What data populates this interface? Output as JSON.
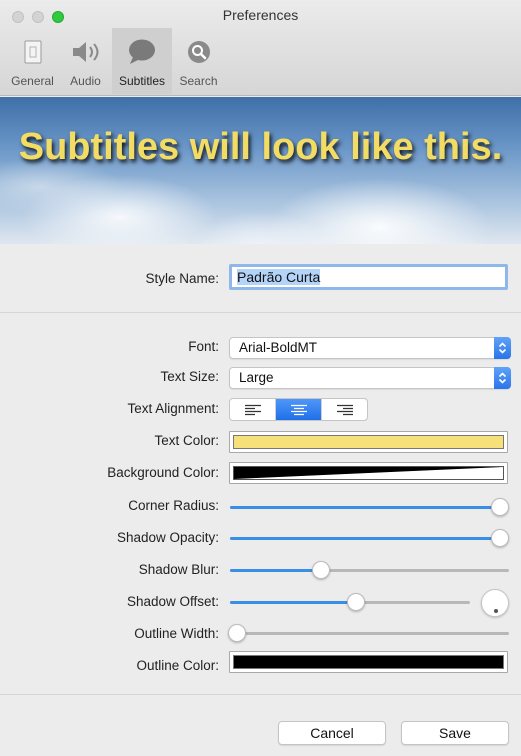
{
  "window": {
    "title": "Preferences"
  },
  "toolbar": {
    "tabs": [
      {
        "label": "General",
        "icon": "general-icon"
      },
      {
        "label": "Audio",
        "icon": "speaker-icon"
      },
      {
        "label": "Subtitles",
        "icon": "speech-bubble-icon",
        "selected": true
      },
      {
        "label": "Search",
        "icon": "search-icon"
      }
    ]
  },
  "preview": {
    "text": "Subtitles will look like this.",
    "text_color": "#f3dc63"
  },
  "style": {
    "label": "Style Name:",
    "value": "Padrão Curta"
  },
  "font": {
    "label": "Font:",
    "value": "Arial-BoldMT"
  },
  "text_size": {
    "label": "Text Size:",
    "value": "Large"
  },
  "text_alignment": {
    "label": "Text Alignment:",
    "options": [
      "left",
      "center",
      "right"
    ],
    "selected": "center"
  },
  "text_color": {
    "label": "Text Color:",
    "value": "#f5e07a"
  },
  "background_color": {
    "label": "Background Color:",
    "value": "#000000"
  },
  "corner_radius": {
    "label": "Corner Radius:",
    "value": 1.0
  },
  "shadow_opacity": {
    "label": "Shadow Opacity:",
    "value": 1.0
  },
  "shadow_blur": {
    "label": "Shadow Blur:",
    "value": 0.32
  },
  "shadow_offset": {
    "label": "Shadow Offset:",
    "value": 0.53
  },
  "outline_width": {
    "label": "Outline Width:",
    "value": 0.0
  },
  "outline_color": {
    "label": "Outline Color:",
    "value": "#000000"
  },
  "buttons": {
    "cancel": "Cancel",
    "save": "Save"
  },
  "colors": {
    "accent": "#2a75ea",
    "slider_fill": "#3a8ee6"
  }
}
